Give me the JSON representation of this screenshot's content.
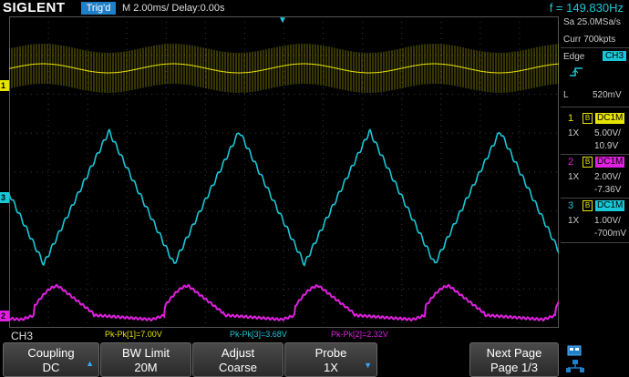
{
  "header": {
    "brand": "SIGLENT",
    "trig_status": "Trig'd",
    "timebase": "M 2.00ms/ Delay:0.00s",
    "frequency": "f = 149.830Hz"
  },
  "right_panel": {
    "sample_rate": "Sa 25.0MSa/s",
    "memory": "Curr 700kpts",
    "trigger_type": "Edge",
    "trigger_source": "CH3",
    "slope_icon": "rising-edge-icon",
    "level_label": "L",
    "level_value": "520mV",
    "channels": [
      {
        "num": "1",
        "coupling": "DC1M",
        "probe": "1X",
        "scale": "5.00V/",
        "offset": "10.9V",
        "color": "#e8e300"
      },
      {
        "num": "2",
        "coupling": "DC1M",
        "probe": "1X",
        "scale": "2.00V/",
        "offset": "-7.36V",
        "color": "#e020e0"
      },
      {
        "num": "3",
        "coupling": "DC1M",
        "probe": "1X",
        "scale": "1.00V/",
        "offset": "-700mV",
        "color": "#19c8d8"
      }
    ]
  },
  "measurements": {
    "active_channel": "CH3",
    "m1": "Pk-Pk[1]=7.00V",
    "m3": "Pk-Pk[3]=3.68V",
    "m2": "Pk-Pk[2]=2.32V"
  },
  "softkeys": {
    "coupling_title": "Coupling",
    "coupling_value": "DC",
    "bw_title": "BW Limit",
    "bw_value": "20M",
    "adjust_title": "Adjust",
    "adjust_value": "Coarse",
    "probe_title": "Probe",
    "probe_value": "1X",
    "next_title": "Next Page",
    "next_value": "Page 1/3"
  },
  "channel_markers": {
    "ch1": "1",
    "ch3": "3",
    "ch2": "2"
  },
  "colors": {
    "ch1": "#e8e300",
    "ch2": "#e020e0",
    "ch3": "#19c8d8",
    "accent": "#1f7fc8"
  }
}
